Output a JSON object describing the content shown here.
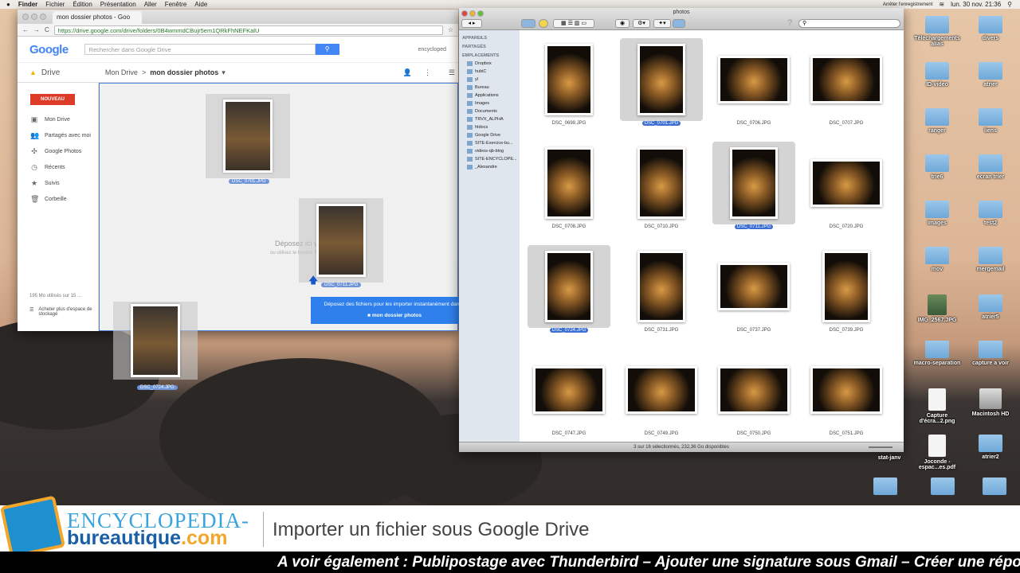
{
  "menubar": {
    "apple": "",
    "items": [
      "Finder",
      "Fichier",
      "Édition",
      "Présentation",
      "Aller",
      "Fenêtre",
      "Aide"
    ],
    "recording": "Arrêter l'enregistrement",
    "datetime": "lun. 30 nov.  21:36"
  },
  "chrome": {
    "tab_title": "mon dossier photos - Goo",
    "url": "https://drive.google.com/drive/folders/0B4wmmdCBujr5em1QRkFhNEFKalU",
    "logo": "Google",
    "search_placeholder": "Rechercher dans Google Drive",
    "account": "encycloped",
    "drive_label": "Drive",
    "breadcrumb_root": "Mon Drive",
    "breadcrumb_sep": ">",
    "breadcrumb_current": "mon dossier photos",
    "new_button": "NOUVEAU",
    "sidebar": [
      {
        "icon": "drive-icon",
        "label": "Mon Drive"
      },
      {
        "icon": "people-icon",
        "label": "Partagés avec moi"
      },
      {
        "icon": "photos-icon",
        "label": "Google Photos"
      },
      {
        "icon": "clock-icon",
        "label": "Récents"
      },
      {
        "icon": "star-icon",
        "label": "Suivis"
      },
      {
        "icon": "trash-icon",
        "label": "Corbeille"
      }
    ],
    "storage": "195 Mo utilisés sur 15 ...",
    "buy_storage": "Acheter plus d'espace de stockage",
    "drop_hint": "Déposez ici vos fichiers",
    "drop_sub": "ou utilisez le bouton \"Nouveau\"",
    "drop_banner": "Déposez des fichiers pour les importer instantanément dans :",
    "drop_folder": "mon dossier photos",
    "drag_labels": [
      "DSC_0701.JPG",
      "DSC_0711.JPG",
      "DSC_0724.JPG"
    ]
  },
  "finder": {
    "title": "photos",
    "status": "3 sur 16 sélectionnés, 232,36 Go disponibles",
    "sidebar": {
      "devices": "APPAREILS",
      "shared": "PARTAGÉS",
      "places": "EMPLACEMENTS",
      "items": [
        "Dropbox",
        "hubiC",
        "yl",
        "Bureau",
        "Applications",
        "Images",
        "Documents",
        "TRVX_ALPHA",
        "htdocs",
        "Google Drive",
        "SITE-Exercice-bu...",
        "videos-qb-blog",
        "SITE-ENCYCLOPE...",
        "_Alexandre"
      ]
    },
    "files": [
      {
        "name": "DSC_0699.JPG",
        "orient": "p",
        "selected": false
      },
      {
        "name": "DSC_0701.JPG",
        "orient": "p",
        "selected": true
      },
      {
        "name": "DSC_0706.JPG",
        "orient": "l",
        "selected": false
      },
      {
        "name": "DSC_0707.JPG",
        "orient": "l",
        "selected": false
      },
      {
        "name": "DSC_0708.JPG",
        "orient": "p",
        "selected": false
      },
      {
        "name": "DSC_0710.JPG",
        "orient": "p",
        "selected": false
      },
      {
        "name": "DSC_0711.JPG",
        "orient": "p",
        "selected": true
      },
      {
        "name": "DSC_0720.JPG",
        "orient": "l",
        "selected": false
      },
      {
        "name": "DSC_0724.JPG",
        "orient": "p",
        "selected": true
      },
      {
        "name": "DSC_0731.JPG",
        "orient": "p",
        "selected": false
      },
      {
        "name": "DSC_0737.JPG",
        "orient": "l",
        "selected": false
      },
      {
        "name": "DSC_0739.JPG",
        "orient": "p",
        "selected": false
      },
      {
        "name": "DSC_0747.JPG",
        "orient": "l",
        "selected": false
      },
      {
        "name": "DSC_0749.JPG",
        "orient": "l",
        "selected": false
      },
      {
        "name": "DSC_0750.JPG",
        "orient": "l",
        "selected": false
      },
      {
        "name": "DSC_0751.JPG",
        "orient": "l",
        "selected": false
      }
    ]
  },
  "desktop": [
    {
      "label": "Téléchargements alias",
      "type": "folder"
    },
    {
      "label": "divers",
      "type": "folder"
    },
    {
      "label": "ID-video",
      "type": "folder"
    },
    {
      "label": "atrier",
      "type": "folder"
    },
    {
      "label": "ranger",
      "type": "folder"
    },
    {
      "label": "liens",
      "type": "folder"
    },
    {
      "label": "trie6",
      "type": "folder"
    },
    {
      "label": "ecran trier",
      "type": "folder"
    },
    {
      "label": "images",
      "type": "folder"
    },
    {
      "label": "test2",
      "type": "folder"
    },
    {
      "label": "mov",
      "type": "folder"
    },
    {
      "label": "mergemail",
      "type": "folder"
    },
    {
      "label": "IMG_2567.JPG",
      "type": "img"
    },
    {
      "label": "atrier5",
      "type": "folder"
    },
    {
      "label": "macro-separation",
      "type": "folder"
    },
    {
      "label": "capture a voir",
      "type": "folder"
    },
    {
      "label": "Capture d'écra...2.png",
      "type": "doc"
    },
    {
      "label": "Macintosh HD",
      "type": "hd"
    },
    {
      "label": "Joconde - espac...es.pdf",
      "type": "doc"
    },
    {
      "label": "atrier2",
      "type": "folder"
    }
  ],
  "desktop_extra": "stat-janv",
  "banner": {
    "brand_top": "ENCYCLOPEDIA-",
    "brand_bottom": "bureautique",
    "brand_tld": ".com",
    "title": "Importer un fichier sous Google Drive",
    "ticker": "A voir également : Publipostage avec Thunderbird – Ajouter une signature sous Gmail – Créer une répons"
  }
}
